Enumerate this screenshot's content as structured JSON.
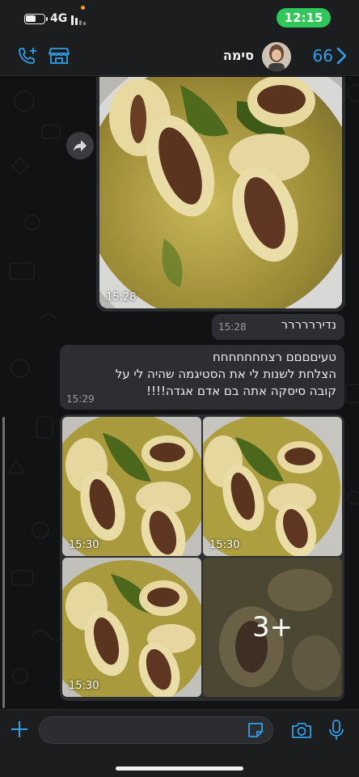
{
  "status_bar": {
    "network": "4G",
    "time": "12:15"
  },
  "header": {
    "back_count": "66",
    "contact_name": "סימה",
    "icons": [
      "add-call-icon",
      "store-icon",
      "chevron-left-icon"
    ]
  },
  "messages": {
    "top_photo": {
      "time": "15:28"
    },
    "text_1": {
      "text": "נדירררררר",
      "time": "15:28"
    },
    "text_2": {
      "lines": [
        "טעיםםםם רצחחחחחחח",
        "הצלחת לשנות לי את הסטיגמה שהיה לי על",
        "קובה סיסקה אתה בם אדם אגדה!!!!"
      ],
      "time": "15:29"
    },
    "photo_grid": {
      "times": [
        "15:30",
        "15:30",
        "15:30"
      ],
      "more_count": "3+"
    }
  },
  "colors": {
    "accent": "#2fa0e8",
    "time_pill": "#30c75a",
    "bubble": "#2d2e31",
    "chat_background": "#111213"
  }
}
